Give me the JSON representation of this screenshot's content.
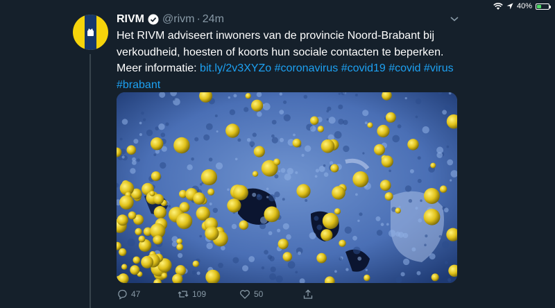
{
  "status_bar": {
    "battery_percent": "40%",
    "battery_level": 0.4,
    "icons": [
      "wifi-icon",
      "location-icon",
      "battery-icon"
    ]
  },
  "tweet": {
    "author_name": "RIVM",
    "handle": "@rivm",
    "separator": "·",
    "timestamp": "24m",
    "text_line1": "Het RIVM adviseert inwoners van de provincie Noord-Brabant bij",
    "text_line2": "verkoudheid, hoesten of koorts hun sociale contacten te beperken.",
    "text_line3_prefix": "Meer informatie: ",
    "link": "bit.ly/2v3XYZo",
    "hashtag1": "#coronavirus",
    "hashtag2": "#covid19",
    "hashtag3": "#covid",
    "hashtag4": "#virus",
    "hashtag5": "#brabant",
    "image_description": "",
    "actions": {
      "replies": "47",
      "retweets": "109",
      "likes": "50"
    }
  },
  "colors": {
    "background": "#15202b",
    "link": "#1da1f2",
    "muted": "#8899a6",
    "avatar_yellow": "#f6d40b",
    "avatar_blue": "#17376b"
  }
}
